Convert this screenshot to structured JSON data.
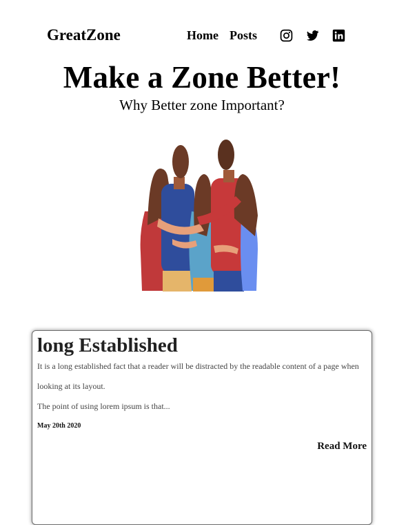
{
  "nav": {
    "brand": "GreatZone",
    "links": [
      "Home",
      "Posts"
    ],
    "social_icons": [
      "instagram-icon",
      "twitter-icon",
      "linkedin-icon"
    ]
  },
  "hero": {
    "title": "Make a Zone Better!",
    "subtitle": "Why Better zone Important?"
  },
  "post": {
    "title": "long Established",
    "paragraph_1_line_1": "It is a long established fact that a reader will be distracted by the readable content of a page when",
    "paragraph_1_line_2": "looking at its layout.",
    "paragraph_2": "The point of using lorem ipsum is that...",
    "date": "May 20th 2020",
    "read_more": "Read More"
  },
  "colors": {
    "text": "#000000",
    "card_border": "#6b6b6b",
    "body_text": "#444444"
  }
}
